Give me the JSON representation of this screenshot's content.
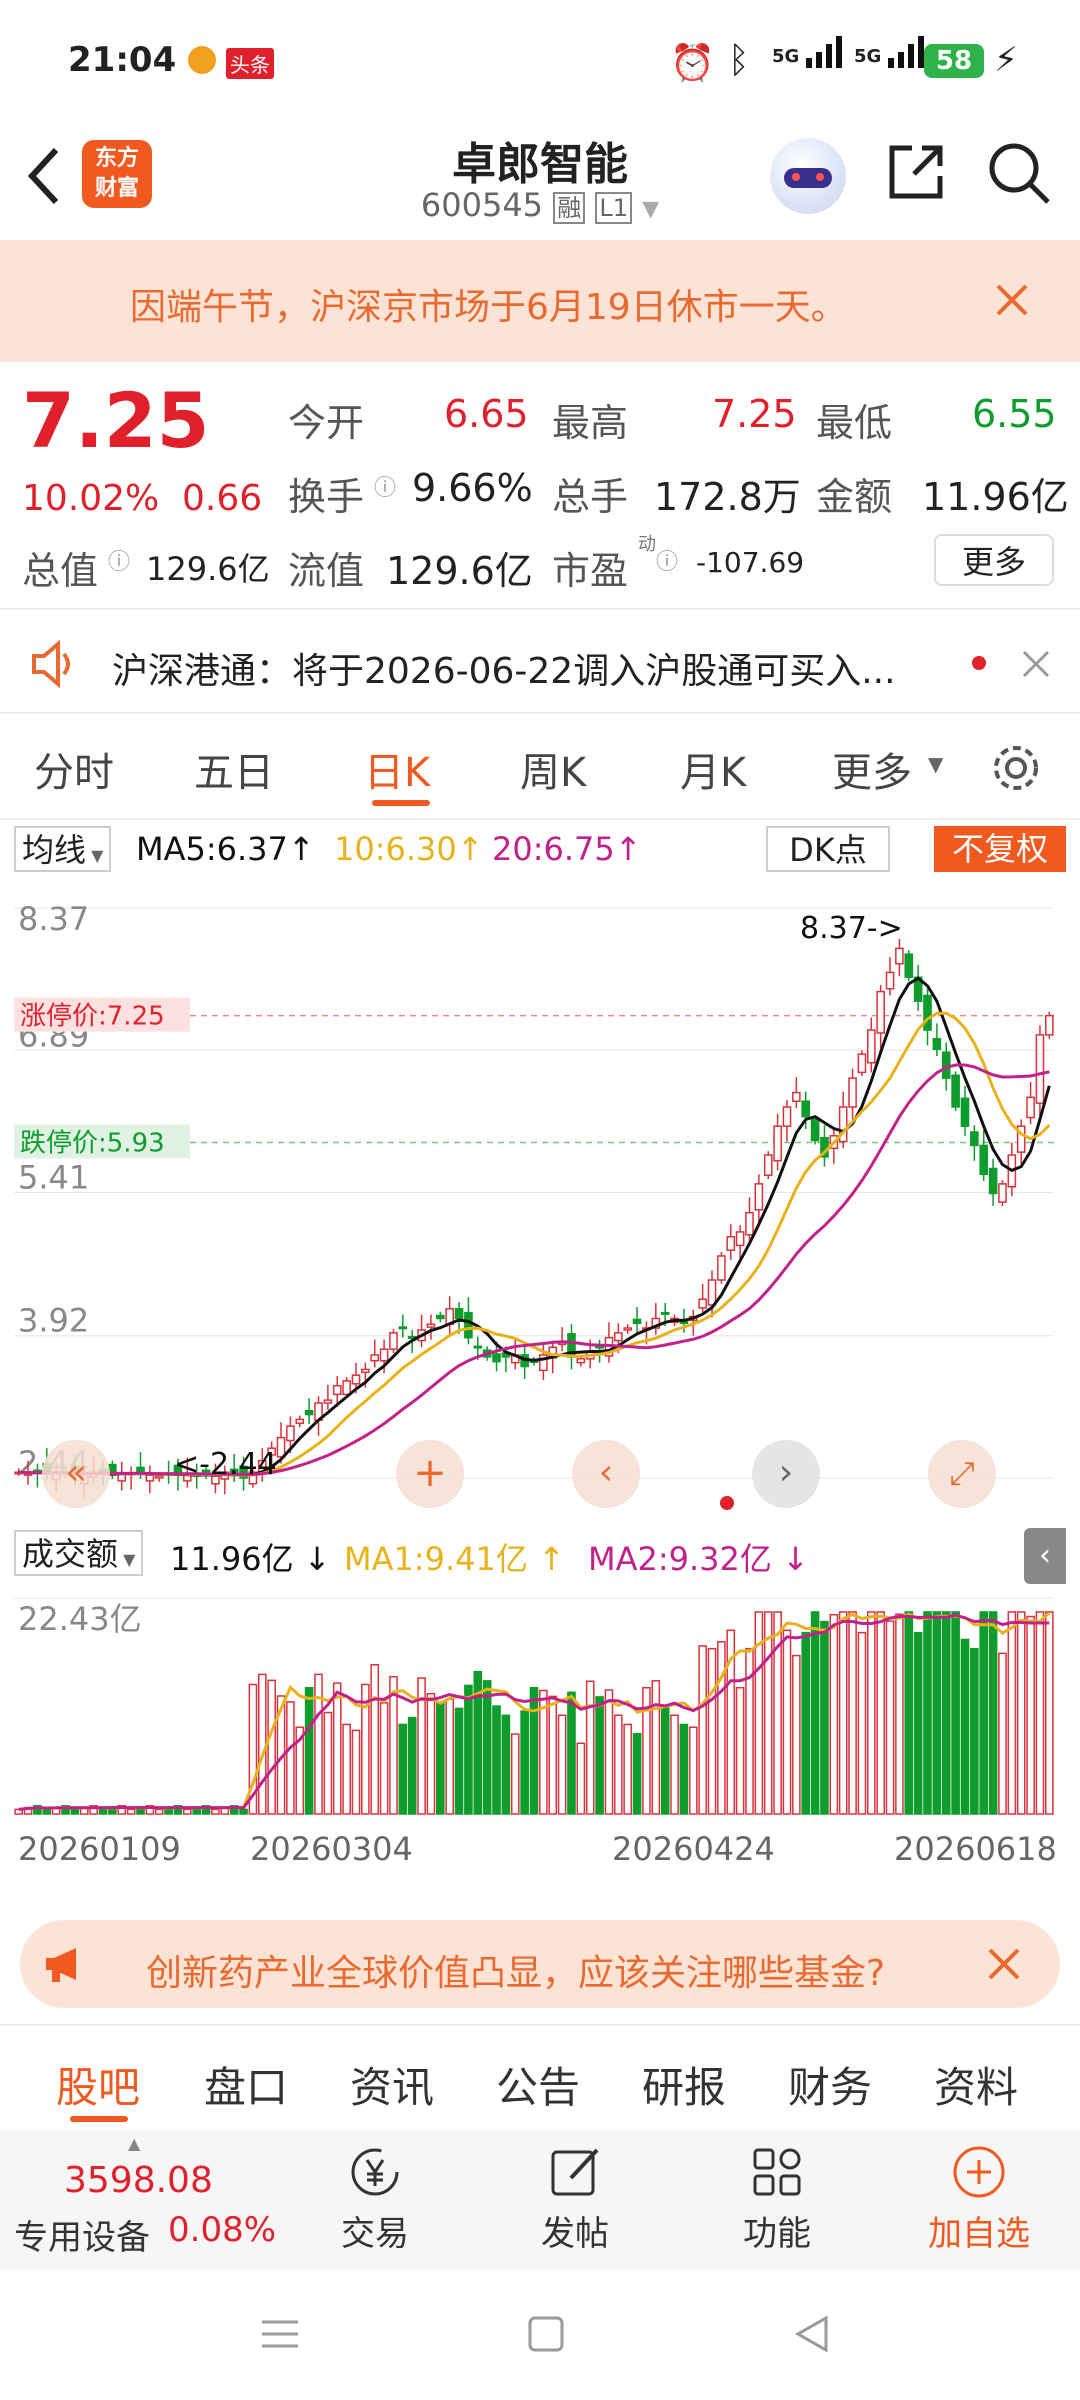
{
  "statusbar": {
    "time": "21:04",
    "app_badge": "头条",
    "battery": "58",
    "net1": "5G",
    "net2": "5G"
  },
  "header": {
    "logo_line1": "东方",
    "logo_line2": "财富",
    "stock_name": "卓郎智能",
    "stock_code": "600545",
    "badge_margin": "融",
    "badge_level": "L1"
  },
  "notice": {
    "text": "因端午节，沪深京市场于6月19日休市一天。"
  },
  "quote": {
    "price": "7.25",
    "pct": "10.02%",
    "change": "0.66",
    "open_label": "今开",
    "open": "6.65",
    "high_label": "最高",
    "high": "7.25",
    "low_label": "最低",
    "low": "6.55",
    "turnover_label": "换手",
    "turnover": "9.66%",
    "volume_label": "总手",
    "volume": "172.8万",
    "amount_label": "金额",
    "amount": "11.96亿",
    "mktcap_label": "总值",
    "mktcap": "129.6亿",
    "float_label": "流值",
    "float": "129.6亿",
    "pe_label": "市盈",
    "pe_sup": "动",
    "pe": "-107.69",
    "more": "更多"
  },
  "hk_notice": {
    "text": "沪深港通：将于2026-06-22调入沪股通可买入..."
  },
  "tabs": [
    "分时",
    "五日",
    "日K",
    "周K",
    "月K",
    "更多"
  ],
  "ma_bar": {
    "selector": "均线",
    "ma5": "MA5:6.37",
    "ma10": "10:6.30",
    "ma20": "20:6.75",
    "dk": "DK点",
    "adjust": "不复权"
  },
  "colors": {
    "accent": "#e0212c",
    "up": "#d8333b",
    "down": "#0e9c2d",
    "ma5": "#111111",
    "ma10": "#e7b21a",
    "ma20": "#c2218c",
    "orange": "#f2591f"
  },
  "chart_data": {
    "type": "candlestick",
    "price_axis": {
      "ticks": [
        "8.37",
        "6.89",
        "5.41",
        "3.92",
        "2.44"
      ],
      "range": [
        2.44,
        8.37
      ]
    },
    "limit_up_label": "涨停价:7.25",
    "limit_down_label": "跌停价:5.93",
    "max_annotation": "8.37->",
    "min_annotation": "<-2.44",
    "x_labels": [
      "20260109",
      "20260304",
      "20260424",
      "20260618"
    ],
    "close": [
      2.5,
      2.49,
      2.5,
      2.48,
      2.5,
      2.49,
      2.47,
      2.48,
      2.5,
      2.49,
      2.47,
      2.48,
      2.49,
      2.5,
      2.47,
      2.46,
      2.48,
      2.47,
      2.49,
      2.46,
      2.47,
      2.46,
      2.5,
      2.47,
      2.44,
      2.5,
      2.62,
      2.75,
      2.86,
      2.98,
      3.05,
      3.1,
      3.22,
      3.25,
      3.4,
      3.45,
      3.51,
      3.57,
      3.72,
      3.78,
      3.95,
      4.0,
      3.9,
      3.98,
      4.04,
      4.1,
      4.2,
      4.1,
      3.9,
      3.8,
      3.7,
      3.65,
      3.7,
      3.72,
      3.6,
      3.65,
      3.72,
      3.8,
      3.85,
      3.7,
      3.68,
      3.75,
      3.8,
      3.9,
      3.95,
      4.0,
      4.05,
      4.0,
      4.1,
      4.15,
      4.1,
      4.05,
      4.12,
      4.3,
      4.5,
      4.75,
      4.95,
      5.0,
      5.2,
      5.5,
      5.8,
      6.1,
      6.3,
      6.45,
      6.2,
      5.95,
      5.78,
      6.0,
      6.3,
      6.6,
      6.85,
      7.1,
      7.5,
      7.7,
      7.95,
      7.65,
      7.4,
      7.1,
      6.9,
      6.6,
      6.3,
      6.1,
      5.9,
      5.6,
      5.4,
      5.5,
      5.8,
      6.1,
      6.4,
      7.05,
      7.25
    ],
    "volume": {
      "ticks": [
        "22.43亿"
      ],
      "max": 22.43,
      "label_selector": "成交额",
      "current": "11.96亿",
      "ma1": "MA1:9.41亿",
      "ma2": "MA2:9.32亿"
    }
  },
  "ad_banner": {
    "text": "创新药产业全球价值凸显，应该关注哪些基金?"
  },
  "sub_tabs": [
    "股吧",
    "盘口",
    "资讯",
    "公告",
    "研报",
    "财务",
    "资料"
  ],
  "bottom_nav": {
    "index_value": "3598.08",
    "index_name": "专用设备",
    "index_pct": "0.08%",
    "trade": "交易",
    "post": "发帖",
    "func": "功能",
    "add": "加自选"
  }
}
